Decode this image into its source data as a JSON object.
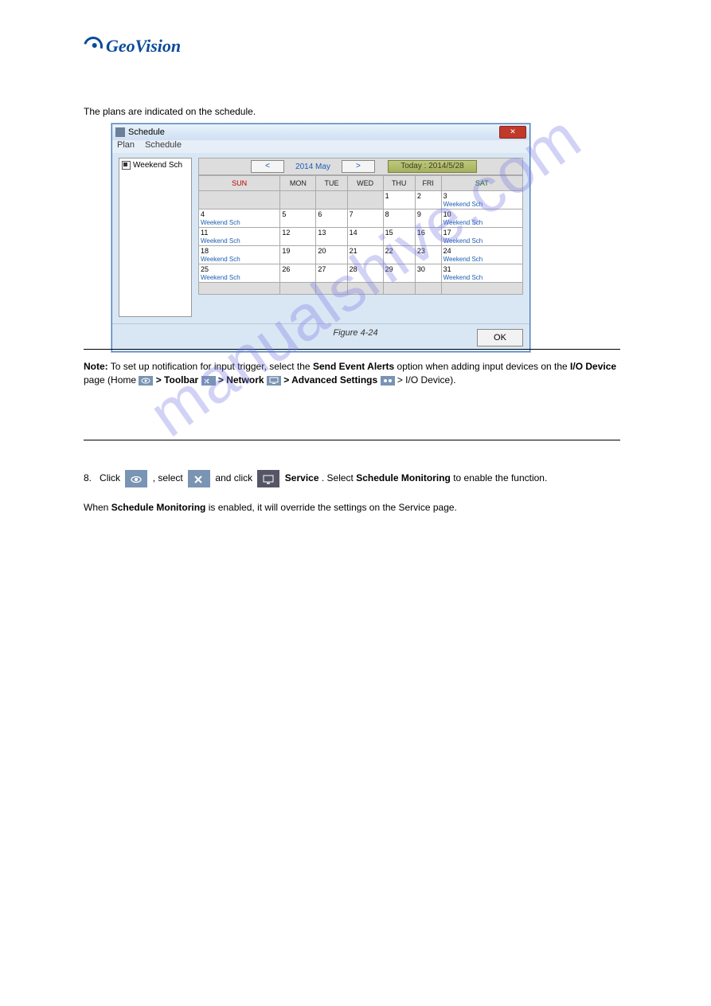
{
  "logo_text": "GeoVision",
  "intro_line": "The plans are indicated on the schedule.",
  "window": {
    "title": "Schedule",
    "menu": {
      "plan": "Plan",
      "schedule": "Schedule"
    },
    "sidebar_item": "Weekend Sch",
    "nav": {
      "prev": "<",
      "next": ">",
      "month": "2014 May",
      "today": "Today : 2014/5/28"
    },
    "headers": {
      "sun": "SUN",
      "mon": "MON",
      "tue": "TUE",
      "wed": "WED",
      "thu": "THU",
      "fri": "FRI",
      "sat": "SAT"
    },
    "weekend_label": "Weekend Sch",
    "grid": [
      [
        "",
        "",
        "",
        "1",
        "2",
        "3"
      ],
      [
        "4",
        "5",
        "6",
        "7",
        "8",
        "9",
        "10"
      ],
      [
        "11",
        "12",
        "13",
        "14",
        "15",
        "16",
        "17"
      ],
      [
        "18",
        "19",
        "20",
        "21",
        "22",
        "23",
        "24"
      ],
      [
        "25",
        "26",
        "27",
        "28",
        "29",
        "30",
        "31"
      ]
    ],
    "ok": "OK"
  },
  "figure_label": "Figure 4-24",
  "note": {
    "label": "Note:",
    "body_a": " To set up notification for input trigger, select the ",
    "bold_a": "Send Event Alerts",
    "body_b": " option when adding input devices on the ",
    "bold_b": "I/O Device",
    "body_c": " page (Home ",
    "bold_c": "> Toolbar ",
    "bold_d": "> Network ",
    "bold_e": "> Advanced Settings ",
    "tail": " > I/O Device)."
  },
  "step8": {
    "num": "8.",
    "a": "Click ",
    "eye": " , select ",
    "tool": " and click ",
    "mon": " ",
    "b_bold": "Service",
    "b": ". Select ",
    "c_bold": "Schedule Monitoring",
    "c": " to enable the function.",
    "line2_a": "When ",
    "line2_bold": "Schedule Monitoring",
    "line2_b": " is enabled, it will override the settings on the Service page."
  },
  "watermark": "manualshive.com"
}
